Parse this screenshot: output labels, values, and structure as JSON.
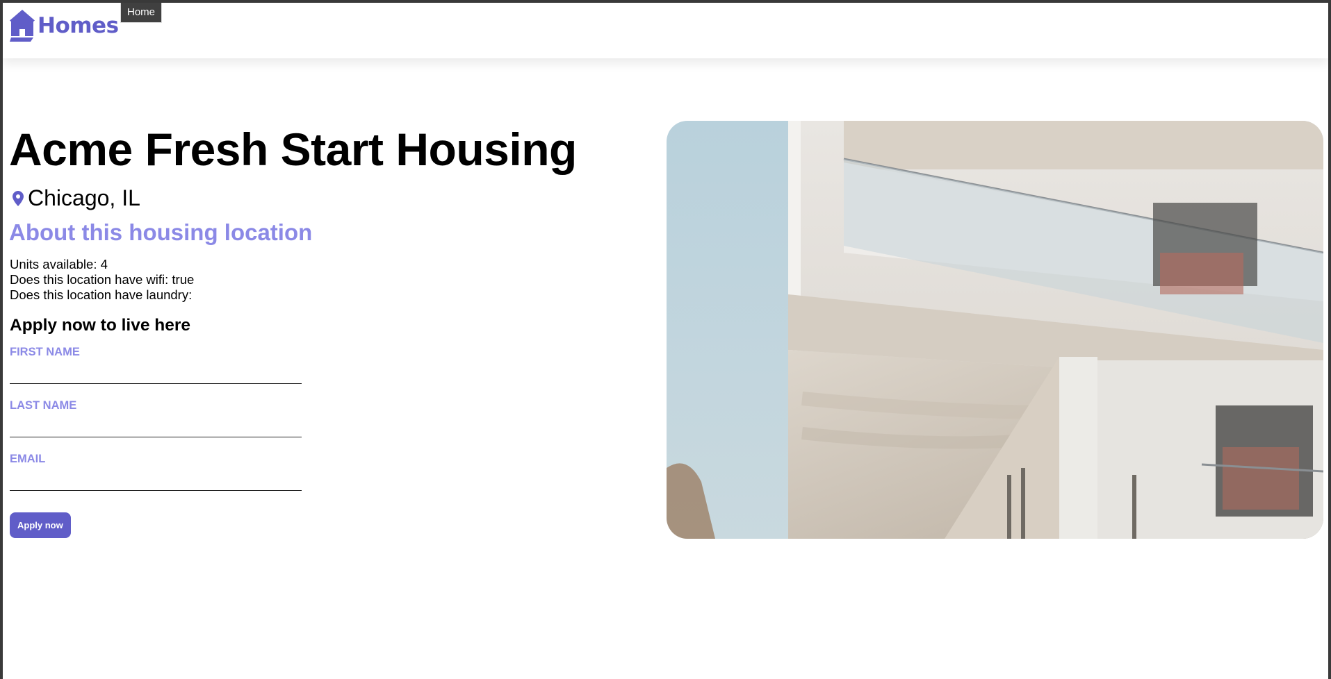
{
  "header": {
    "logo_text": "Homes",
    "tooltip": "Home"
  },
  "details": {
    "name": "Acme Fresh Start Housing",
    "location": "Chicago, IL",
    "section_title": "About this housing location",
    "features": [
      "Units available: 4",
      "Does this location have wifi: true",
      "Does this location have laundry:"
    ]
  },
  "apply": {
    "heading": "Apply now to live here",
    "first_name_label": "FIRST NAME",
    "last_name_label": "LAST NAME",
    "email_label": "EMAIL",
    "first_name_value": "",
    "last_name_value": "",
    "email_value": "",
    "button_label": "Apply now"
  },
  "colors": {
    "brand": "#605dc8",
    "accent_light": "#8b89e6"
  }
}
